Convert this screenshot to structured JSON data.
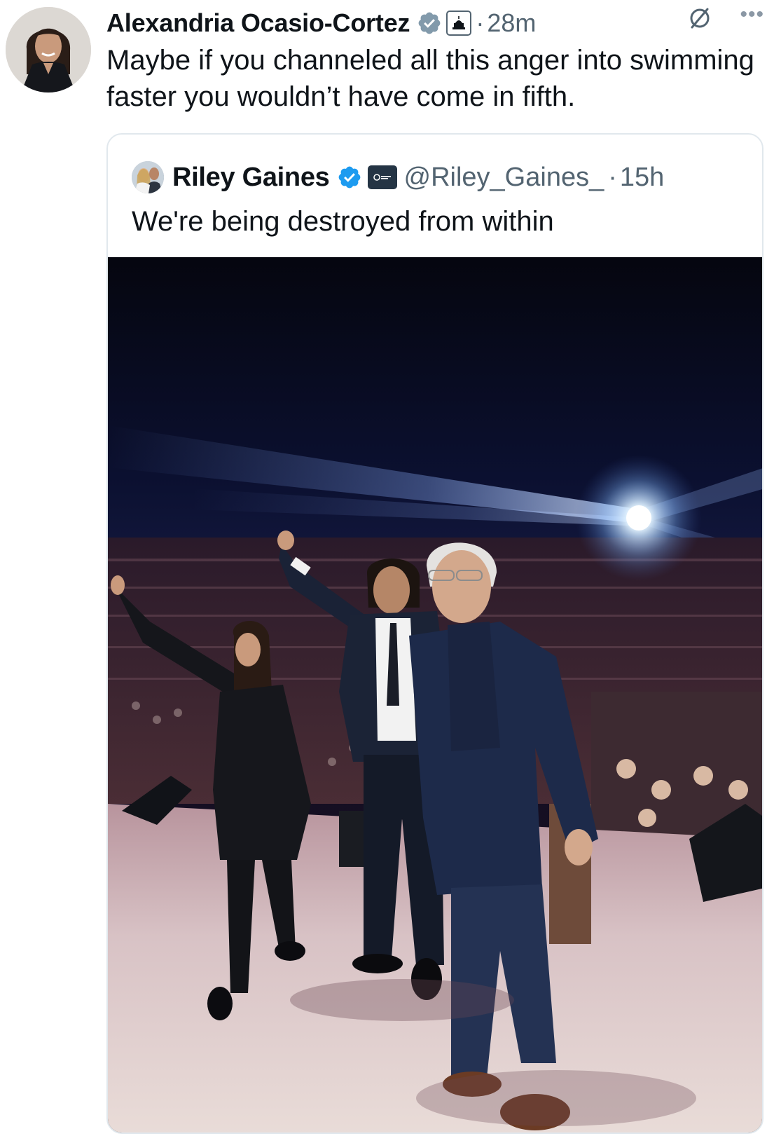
{
  "tweet": {
    "author_name": "Alexandria Ocasio-Cortez",
    "separator": "·",
    "time": "28m",
    "text": "Maybe if you channeled all this anger into swimming faster you wouldn’t have come in fifth.",
    "icons": {
      "verified": "verified-badge-icon",
      "affiliation": "capitol-building-icon",
      "grok": "grok-icon",
      "more": "more-icon"
    }
  },
  "quoted_tweet": {
    "author_name": "Riley Gaines",
    "handle": "@Riley_Gaines_",
    "separator": "·",
    "time": "15h",
    "text": "We're being destroyed from within",
    "icons": {
      "verified": "verified-badge-icon",
      "affiliation": "organization-logo-icon"
    }
  },
  "colors": {
    "text_primary": "#0f1419",
    "text_secondary": "#536471",
    "verified_gray": "#829aab",
    "verified_blue": "#1d9bf0",
    "border": "#e1e8ed"
  }
}
